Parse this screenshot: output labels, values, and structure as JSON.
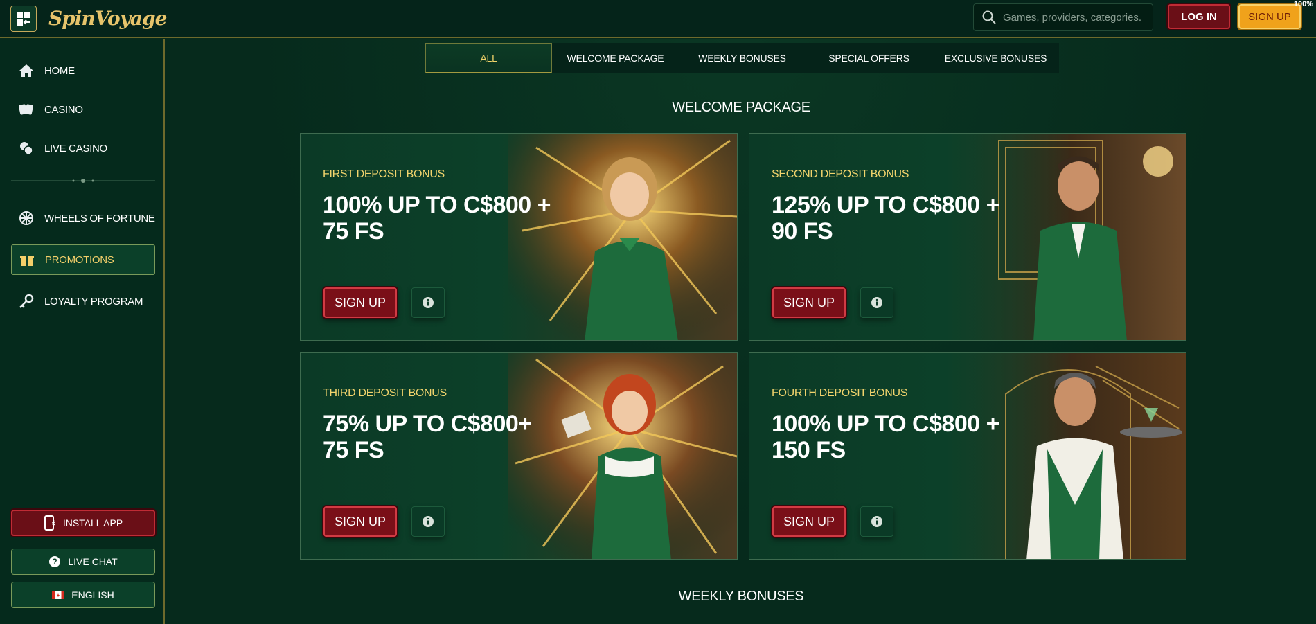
{
  "header": {
    "logo_text": "SpinVoyage",
    "search_placeholder": "Games, providers, categories...",
    "login_label": "LOG IN",
    "signup_label": "SIGN UP",
    "corner_badge": "100%"
  },
  "sidebar": {
    "items": [
      {
        "label": "HOME",
        "icon": "home-icon"
      },
      {
        "label": "CASINO",
        "icon": "cards-icon"
      },
      {
        "label": "LIVE CASINO",
        "icon": "chips-icon"
      },
      {
        "label": "WHEELS OF FORTUNE",
        "icon": "wheel-icon"
      },
      {
        "label": "PROMOTIONS",
        "icon": "gift-icon",
        "active": true
      },
      {
        "label": "LOYALTY PROGRAM",
        "icon": "key-icon"
      }
    ],
    "install_label": "INSTALL APP",
    "chat_label": "LIVE CHAT",
    "language_label": "ENGLISH"
  },
  "tabs": [
    {
      "label": "ALL",
      "active": true
    },
    {
      "label": "WELCOME PACKAGE"
    },
    {
      "label": "WEEKLY BONUSES"
    },
    {
      "label": "SPECIAL OFFERS"
    },
    {
      "label": "EXCLUSIVE BONUSES"
    }
  ],
  "sections": {
    "welcome_title": "WELCOME PACKAGE",
    "weekly_title": "WEEKLY BONUSES"
  },
  "cards": [
    {
      "kicker": "FIRST DEPOSIT BONUS",
      "headline": "100% UP TO C$800 + 75 FS",
      "button": "SIGN UP"
    },
    {
      "kicker": "SECOND DEPOSIT BONUS",
      "headline": "125% UP TO C$800 + 90 FS",
      "button": "SIGN UP"
    },
    {
      "kicker": "THIRD DEPOSIT BONUS",
      "headline": "75% UP TO C$800+ 75 FS",
      "button": "SIGN UP"
    },
    {
      "kicker": "FOURTH DEPOSIT BONUS",
      "headline": "100% UP TO C$800 + 150 FS",
      "button": "SIGN UP"
    }
  ],
  "colors": {
    "accent_gold": "#f2d46d",
    "primary_red": "#7a0f18",
    "background": "#062a1c"
  }
}
